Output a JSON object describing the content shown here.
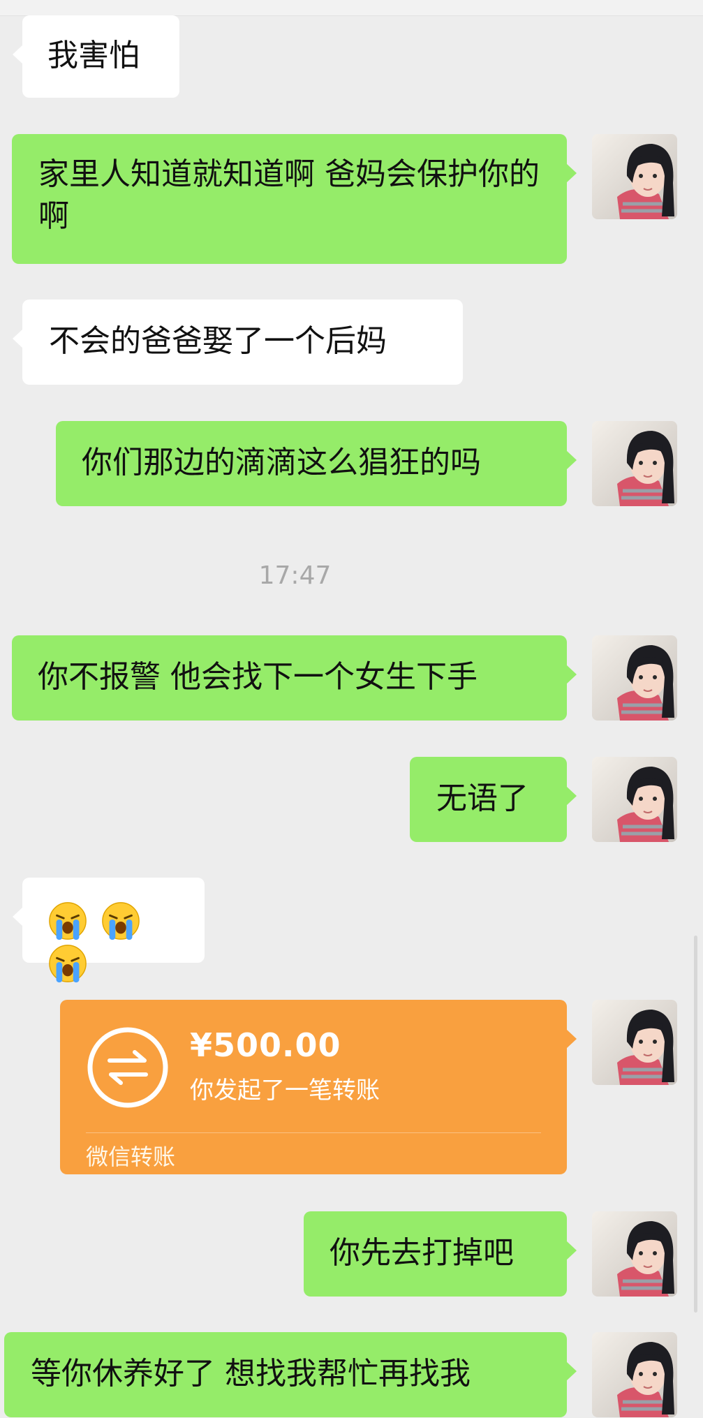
{
  "chat": {
    "messages": [
      {
        "side": "in",
        "text": "我害怕"
      },
      {
        "side": "out",
        "text": "家里人知道就知道啊 爸妈会保护你的啊"
      },
      {
        "side": "in",
        "text": "不会的爸爸娶了一个后妈"
      },
      {
        "side": "out",
        "text": "你们那边的滴滴这么猖狂的吗"
      },
      {
        "side": "out",
        "text": "你不报警 他会找下一个女生下手"
      },
      {
        "side": "out",
        "text": "无语了"
      },
      {
        "side": "out",
        "text": "你先去打掉吧"
      },
      {
        "side": "out",
        "text": "等你休养好了  想找我帮忙再找我"
      }
    ],
    "timestamp": "17:47",
    "emoji_message": {
      "emoji_name": "loudly-crying-face",
      "count": 3
    },
    "transfer": {
      "amount": "¥500.00",
      "description": "你发起了一笔转账",
      "label": "微信转账",
      "icon": "transfer-arrows-icon"
    }
  },
  "colors": {
    "background": "#ededed",
    "incoming_bubble": "#ffffff",
    "outgoing_bubble": "#95ec69",
    "transfer_card": "#f9a03f",
    "timestamp_text": "#a8a8a8"
  }
}
